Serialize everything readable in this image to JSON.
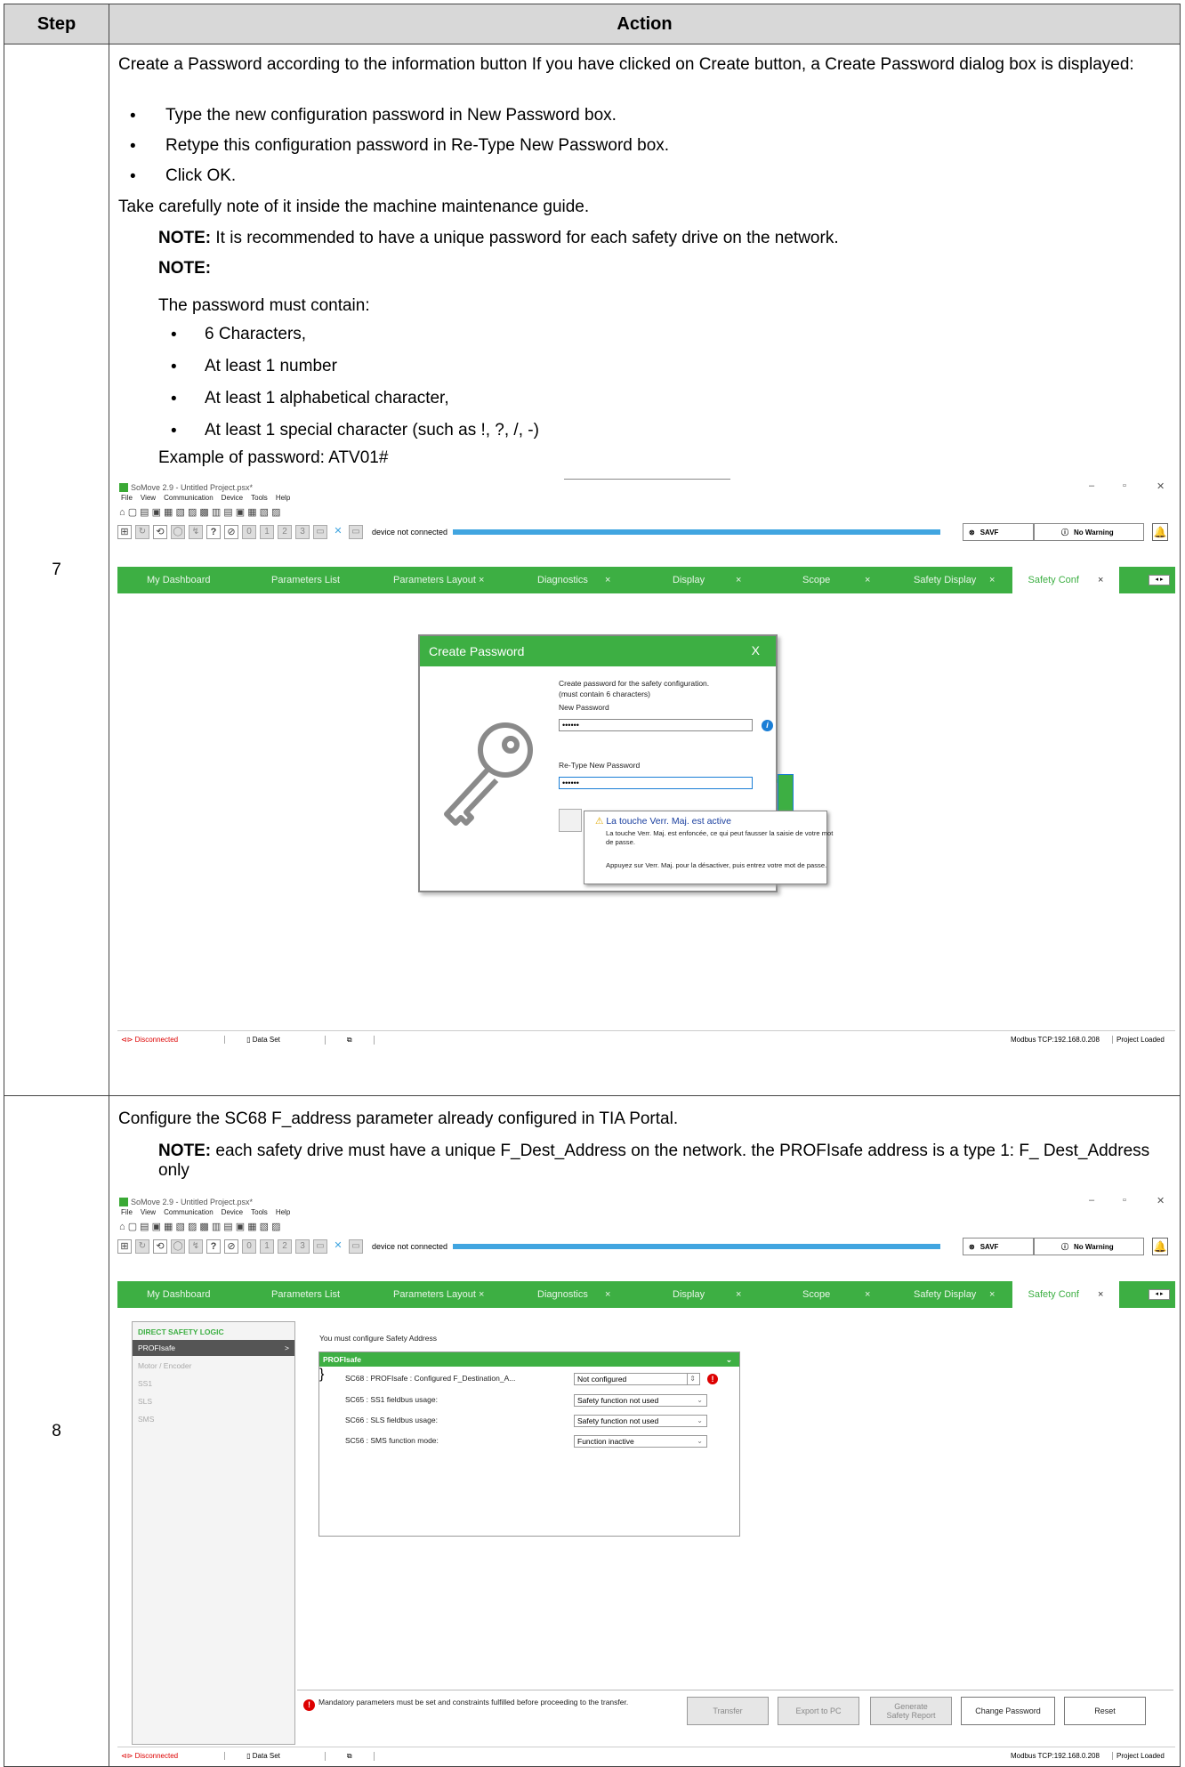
{
  "table": {
    "header_step": "Step",
    "header_action": "Action"
  },
  "step7": {
    "num": "7",
    "intro": "Create a Password according to the information button If you have clicked on Create button, a Create Password dialog box is displayed:",
    "bullets": [
      "Type the new configuration password in New Password box.",
      "Retype this configuration password in Re-Type New Password box.",
      "Click OK."
    ],
    "bullet_glyph": "•",
    "note_line": "Take carefully note of it inside the machine maintenance guide.",
    "note1_label": "NOTE:",
    "note1_text": " It is recommended to have a unique password for each safety drive on the network.",
    "note2_label": "NOTE:",
    "must_contain": "The password must contain:",
    "rules": [
      "6 Characters,",
      "At least 1 number",
      "At least 1 alphabetical character,",
      "At least 1 special character (such as !, ?, /, -)"
    ],
    "example": "Example of password: ATV01#"
  },
  "step8": {
    "num": "8",
    "intro": "Configure the SC68 F_address parameter already configured in TIA Portal.",
    "note_label": "NOTE:",
    "note_text": " each safety drive must have a unique F_Dest_Address on the network. the PROFIsafe address is a type 1: F_ Dest_Address only"
  },
  "app": {
    "title": "SoMove 2.9 - Untitled Project.psx*",
    "win_min": "–",
    "win_max": "▫",
    "win_close": "✕",
    "menu": [
      "File",
      "View",
      "Communication",
      "Device",
      "Tools",
      "Help"
    ],
    "toolbar_glyphs": "⌂ ▢ ▤ ▣ ▦ ▧ ▨ ▩ ▥ ▤ ▣ ▦ ▧ ▨",
    "device_status": "device not connected",
    "savf": "SAVF",
    "savf_icon": "⊗",
    "no_warning": "No Warning",
    "warn_icon": "ⓘ",
    "bell": "🔔",
    "tb_icons": [
      "⊞",
      "↻",
      "⟲",
      "◯",
      "↯",
      "?",
      "⊘",
      "0",
      "1",
      "2",
      "3",
      "▭",
      "✕",
      "▭"
    ],
    "tabs": [
      "My Dashboard",
      "Parameters List",
      "Parameters Layout",
      "Diagnostics",
      "Display",
      "Scope",
      "Safety Display",
      "Safety Conf"
    ],
    "tab_close": "×",
    "scroll": "◂ ▸",
    "status_disconnected": "Disconnected",
    "status_disconnected_icon": "⊲⊳",
    "status_dataset": "Data Set",
    "status_dataset_icon": "▯",
    "status_modbus": "Modbus TCP:192.168.0.208",
    "status_project": "Project Loaded"
  },
  "dialog": {
    "title": "Create Password",
    "close": "X",
    "hint1": "Create password for the safety configuration.",
    "hint2": "(must contain 6 characters)",
    "new_label": "New Password",
    "new_value": "••••••",
    "retype_label": "Re-Type New Password",
    "retype_value": "••••••",
    "info_icon": "i",
    "eye_icon": "👁",
    "tip_icon": "⚠",
    "tip_title": "La touche Verr. Maj. est active",
    "tip_l1": "La touche Verr. Maj. est enfoncée, ce qui peut fausser la saisie de votre mot",
    "tip_l2": "de passe.",
    "tip_l3": "Appuyez sur Verr. Maj. pour la désactiver, puis entrez votre mot de passe."
  },
  "config": {
    "nav_head": "DIRECT SAFETY LOGIC",
    "nav": [
      "PROFIsafe",
      "Motor / Encoder",
      "SS1",
      "SLS",
      "SMS"
    ],
    "nav_arrow": ">",
    "msg": "You must configure Safety Address",
    "panel_title": "PROFIsafe",
    "panel_chev": "⌄",
    "rows": [
      {
        "label": "SC68 : PROFIsafe : Configured F_Destination_A...",
        "value": "Not configured"
      },
      {
        "label": "SC65 : SS1 fieldbus usage:",
        "value": "Safety function not used"
      },
      {
        "label": "SC66 : SLS fieldbus usage:",
        "value": "Safety function not used"
      },
      {
        "label": "SC56 : SMS function mode:",
        "value": "Function inactive"
      }
    ],
    "spin": "⇕",
    "err_icon": "!",
    "dd": "⌄",
    "footer_msg": "Mandatory parameters must be set and constraints fulfilled before proceeding to the transfer.",
    "btn_transfer": "Transfer",
    "btn_export": "Export to PC",
    "btn_generate1": "Generate",
    "btn_generate2": "Safety Report",
    "btn_change": "Change Password",
    "btn_reset": "Reset"
  },
  "colors": {
    "green": "#3daf43",
    "header_gray": "#d8d8d8",
    "blue": "#41a5e0",
    "error": "#d00"
  }
}
